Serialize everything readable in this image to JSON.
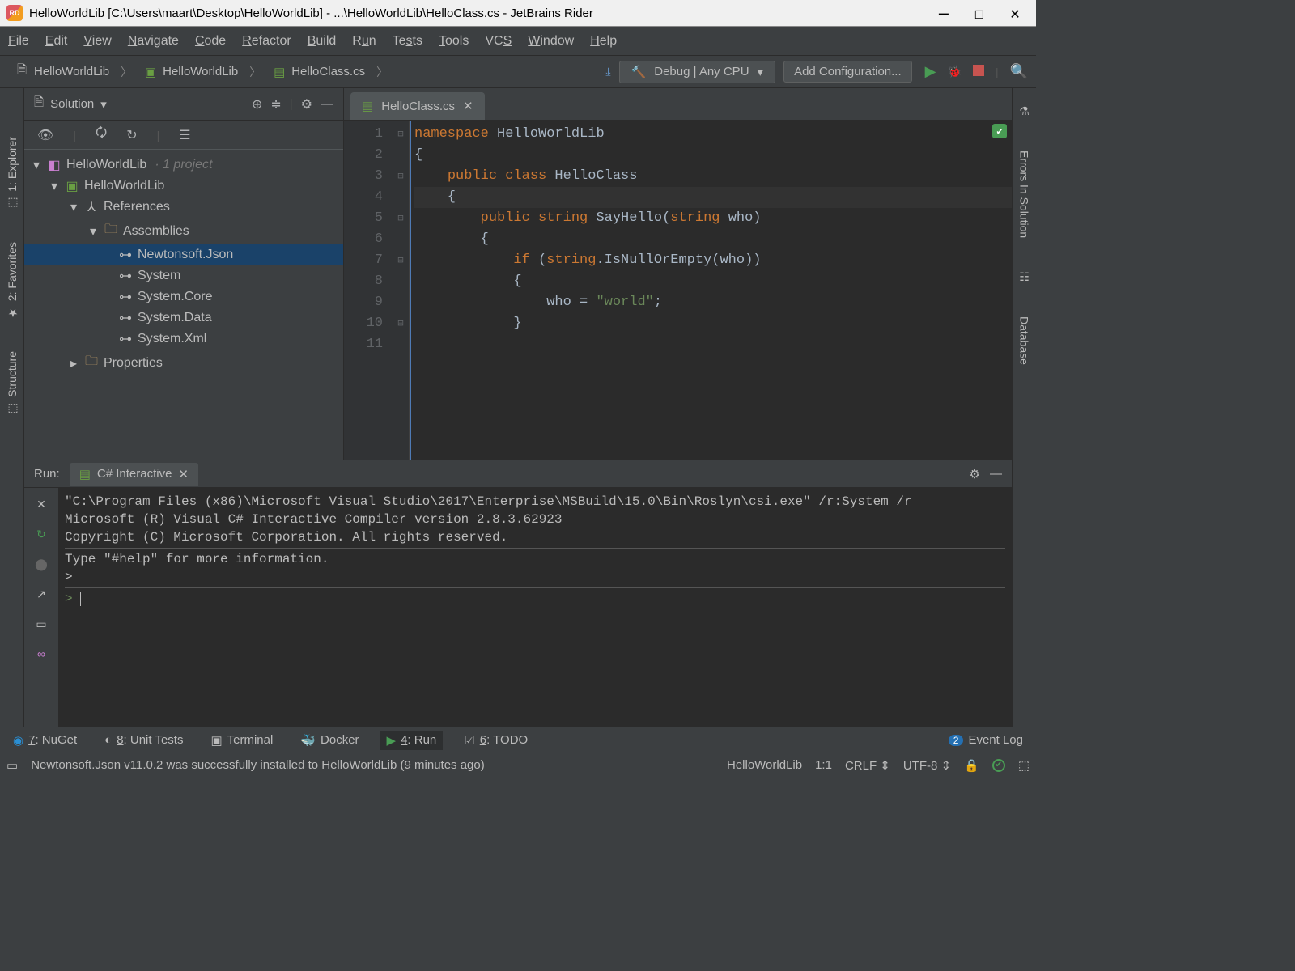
{
  "titlebar": {
    "text": "HelloWorldLib [C:\\Users\\maart\\Desktop\\HelloWorldLib] - ...\\HelloWorldLib\\HelloClass.cs - JetBrains Rider"
  },
  "menubar": {
    "items": [
      "File",
      "Edit",
      "View",
      "Navigate",
      "Code",
      "Refactor",
      "Build",
      "Run",
      "Tests",
      "Tools",
      "VCS",
      "Window",
      "Help"
    ]
  },
  "breadcrumbs": {
    "items": [
      "HelloWorldLib",
      "HelloWorldLib",
      "HelloClass.cs"
    ]
  },
  "config": {
    "selected": "Debug | Any CPU",
    "add": "Add Configuration..."
  },
  "explorer": {
    "title": "Solution",
    "root": {
      "name": "HelloWorldLib",
      "suffix": "· 1 project"
    },
    "project": "HelloWorldLib",
    "references": "References",
    "assemblies": "Assemblies",
    "asm_items": [
      "Newtonsoft.Json",
      "System",
      "System.Core",
      "System.Data",
      "System.Xml"
    ],
    "properties": "Properties"
  },
  "left_tabs": {
    "explorer": "1: Explorer",
    "favorites": "2: Favorites",
    "structure": "Structure"
  },
  "right_tabs": {
    "errors": "Errors In Solution",
    "database": "Database"
  },
  "editor": {
    "tab": "HelloClass.cs",
    "lines": [
      {
        "n": 1,
        "code": [
          {
            "t": "namespace",
            "c": "kw"
          },
          {
            "t": " HelloWorldLib",
            "c": ""
          }
        ]
      },
      {
        "n": 2,
        "code": [
          {
            "t": "{",
            "c": ""
          }
        ]
      },
      {
        "n": 3,
        "code": [
          {
            "t": "    ",
            "c": ""
          },
          {
            "t": "public class",
            "c": "kw"
          },
          {
            "t": " HelloClass",
            "c": ""
          }
        ]
      },
      {
        "n": 4,
        "code": [
          {
            "t": "    {",
            "c": ""
          }
        ],
        "hl": true
      },
      {
        "n": 5,
        "code": [
          {
            "t": "        ",
            "c": ""
          },
          {
            "t": "public string",
            "c": "kw"
          },
          {
            "t": " SayHello(",
            "c": ""
          },
          {
            "t": "string",
            "c": "kw"
          },
          {
            "t": " who)",
            "c": ""
          }
        ]
      },
      {
        "n": 6,
        "code": [
          {
            "t": "        {",
            "c": ""
          }
        ]
      },
      {
        "n": 7,
        "code": [
          {
            "t": "            ",
            "c": ""
          },
          {
            "t": "if",
            "c": "kw"
          },
          {
            "t": " (",
            "c": ""
          },
          {
            "t": "string",
            "c": "kw"
          },
          {
            "t": ".IsNullOrEmpty(who))",
            "c": ""
          }
        ]
      },
      {
        "n": 8,
        "code": [
          {
            "t": "            {",
            "c": ""
          }
        ]
      },
      {
        "n": 9,
        "code": [
          {
            "t": "                who = ",
            "c": ""
          },
          {
            "t": "\"world\"",
            "c": "str"
          },
          {
            "t": ";",
            "c": ""
          }
        ]
      },
      {
        "n": 10,
        "code": [
          {
            "t": "            }",
            "c": ""
          }
        ]
      },
      {
        "n": 11,
        "code": [
          {
            "t": "",
            "c": ""
          }
        ]
      }
    ]
  },
  "run": {
    "label": "Run:",
    "tab": "C# Interactive",
    "lines": [
      "\"C:\\Program Files (x86)\\Microsoft Visual Studio\\2017\\Enterprise\\MSBuild\\15.0\\Bin\\Roslyn\\csi.exe\" /r:System /r",
      "Microsoft (R) Visual C# Interactive Compiler version 2.8.3.62923",
      "Copyright (C) Microsoft Corporation. All rights reserved.",
      "",
      "Type \"#help\" for more information.",
      ">"
    ]
  },
  "bottombar": {
    "nuget": "7: NuGet",
    "unit": "8: Unit Tests",
    "terminal": "Terminal",
    "docker": "Docker",
    "run": "4: Run",
    "todo": "6: TODO",
    "eventlog": "Event Log",
    "badge": "2"
  },
  "statusbar": {
    "msg": "Newtonsoft.Json v11.0.2 was successfully installed to HelloWorldLib (9 minutes ago)",
    "context": "HelloWorldLib",
    "pos": "1:1",
    "eol": "CRLF",
    "enc": "UTF-8"
  }
}
